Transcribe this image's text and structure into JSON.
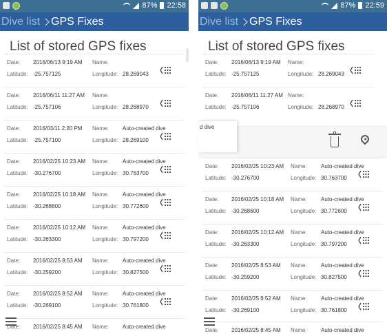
{
  "status_left": {
    "battery": "87%",
    "time": "22:58"
  },
  "status_right": {
    "battery": "87%",
    "time": "22:59"
  },
  "appbar": {
    "back": "Dive list",
    "current": "GPS Fixes"
  },
  "title": "List of stored GPS fixes",
  "labels": {
    "date": "Date:",
    "name": "Name:",
    "lat": "Latitude:",
    "lon": "Longitude:"
  },
  "fixes": [
    {
      "date": "2016/06/13 9:19 AM",
      "name": "",
      "lat": "-25.757125",
      "lon": "28.269043"
    },
    {
      "date": "2016/06/11 11:27 AM",
      "name": "",
      "lat": "-25.757106",
      "lon": "28.268970"
    },
    {
      "date": "2016/03/11 2:20 PM",
      "name": "Auto-created dive",
      "lat": "-25.757100",
      "lon": "28.269100"
    },
    {
      "date": "2016/02/25 10:23 AM",
      "name": "Auto-created dive",
      "lat": "-30.276700",
      "lon": "30.763700"
    },
    {
      "date": "2016/02/25 10:18 AM",
      "name": "Auto-created dive",
      "lat": "-30.268600",
      "lon": "30.772600"
    },
    {
      "date": "2016/02/25 10:12 AM",
      "name": "Auto-created dive",
      "lat": "-30.263300",
      "lon": "30.797200"
    },
    {
      "date": "2016/02/25 8:53 AM",
      "name": "Auto-created dive",
      "lat": "-30.259200",
      "lon": "30.827500"
    },
    {
      "date": "2016/02/25 8:52 AM",
      "name": "Auto-created dive",
      "lat": "-30.269100",
      "lon": "30.761800"
    },
    {
      "date": "2016/02/25 8:45 AM",
      "name": "Auto-created dive",
      "lat": "",
      "lon": ""
    }
  ],
  "peek_text": "d dive",
  "colors": {
    "status_bar": "#3d6f92",
    "app_bar": "#2d5f9e"
  }
}
